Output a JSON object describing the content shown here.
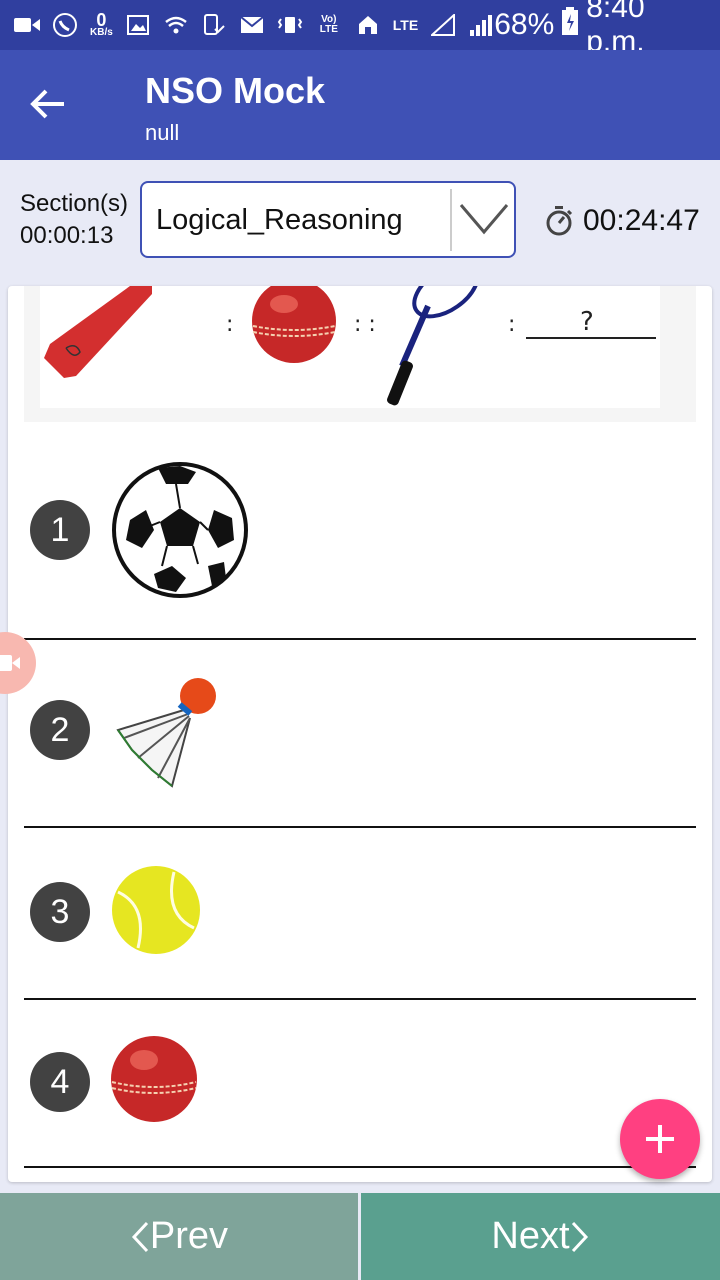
{
  "status_bar": {
    "kbs_value": "0",
    "kbs_unit": "KB/s",
    "volte": "Vo) LTE",
    "lte": "LTE",
    "battery": "68%",
    "time": "8:40 p.m."
  },
  "app_bar": {
    "title": "NSO Mock",
    "subtitle": "null"
  },
  "section": {
    "label": "Section(s)",
    "elapsed": "00:00:13",
    "selected": "Logical_Reasoning",
    "timer": "00:24:47"
  },
  "question": {
    "analogy_blank": "?"
  },
  "options": [
    {
      "number": "1",
      "image": "football"
    },
    {
      "number": "2",
      "image": "shuttlecock"
    },
    {
      "number": "3",
      "image": "tennis-ball"
    },
    {
      "number": "4",
      "image": "cricket-ball"
    }
  ],
  "nav": {
    "prev_label": "Prev",
    "next_label": "Next"
  },
  "colors": {
    "status_bar": "#303f9f",
    "app_bar": "#3f51b5",
    "fab": "#ff4081",
    "prev": "#7fa49a",
    "next": "#5aa08f"
  }
}
